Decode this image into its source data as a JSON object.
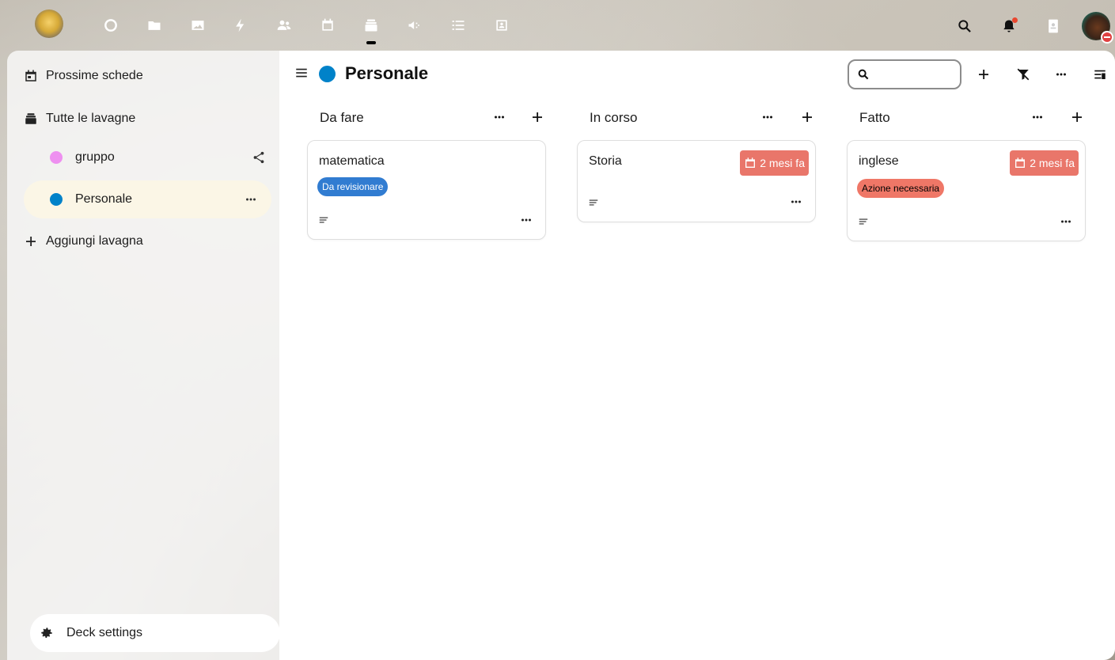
{
  "app": {
    "active_app": "deck",
    "apps": [
      "dashboard-icon",
      "files-icon",
      "photos-icon",
      "activity-icon",
      "contacts-icon",
      "calendar-icon",
      "deck-icon",
      "announcements-icon",
      "tasks-icon",
      "contacts-card-icon"
    ],
    "right_icons": [
      "search-icon",
      "notifications-icon",
      "contacts-menu-icon"
    ],
    "accent": "#0082c9"
  },
  "sidebar": {
    "upcoming": "Prossime schede",
    "all_boards": "Tutte le lavagne",
    "boards": [
      {
        "label": "gruppo",
        "color": "#ee90f0"
      },
      {
        "label": "Personale",
        "color": "#0082c9"
      }
    ],
    "add_board": "Aggiungi lavagna",
    "settings": "Deck settings"
  },
  "board": {
    "title": "Personale",
    "color": "#0082c9",
    "search_placeholder": "",
    "search_value": ""
  },
  "stacks": [
    {
      "title": "Da fare",
      "cards": [
        {
          "title": "matematica",
          "label": "Da revisionare",
          "label_color": "#317cd1",
          "label_text_color": "#ffffff",
          "due": ""
        }
      ]
    },
    {
      "title": "In corso",
      "cards": [
        {
          "title": "Storia",
          "label": "",
          "due": "2 mesi fa"
        }
      ]
    },
    {
      "title": "Fatto",
      "cards": [
        {
          "title": "inglese",
          "label": "Azione necessaria",
          "label_color": "#ef7767",
          "label_text_color": "#000000",
          "due": "2 mesi fa"
        }
      ]
    }
  ]
}
